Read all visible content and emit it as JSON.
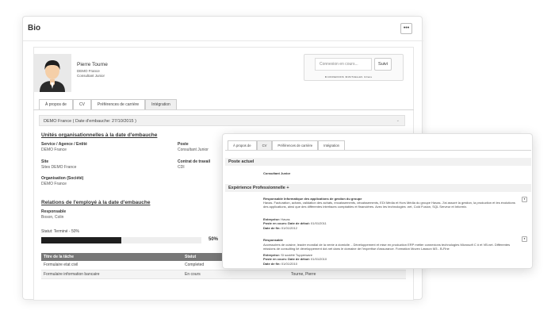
{
  "card": {
    "title": "Bio",
    "more_label": "•••"
  },
  "profile": {
    "name": "Pierre Tourne",
    "company": "DEMO France",
    "role": "Consultant Junior"
  },
  "connect": {
    "placeholder": "Connexion en cours...",
    "follow_label": "Suivi",
    "stats": {
      "connexions_count": "0",
      "connexions_label": "CONNEXIONS",
      "mutuelles_count": "0",
      "mutuelles_label": "MUTUELLES",
      "fans_count": "1",
      "fans_label": "Fans"
    }
  },
  "tabs": [
    {
      "label": "À propos de"
    },
    {
      "label": "CV"
    },
    {
      "label": "Préférences de carrière"
    },
    {
      "label": "Intégration"
    }
  ],
  "accordion": {
    "header": "DEMO France ( Date d'embauche: 27/10/2015 )"
  },
  "org_section": {
    "title": "Unités organisationnelles à la date d'embauche",
    "service_label": "Service / Agence / Entité",
    "service_value": "DEMO France",
    "poste_label": "Poste",
    "poste_value": "Consultant Junior",
    "site_label": "Site",
    "site_value": "Sites DEMO France",
    "contrat_label": "Contrat de travail",
    "contrat_value": "CDI",
    "organisation_label": "Organisation (Société)",
    "organisation_value": "DEMO France"
  },
  "relations_section": {
    "title": "Relations de l'employé à la date d'embauche",
    "responsable_label": "Responsable",
    "responsable_value": "Boson, Colin"
  },
  "status": {
    "label": "Statut: Terminé - 50%",
    "percent_text": "50%",
    "progress": 0.5
  },
  "task_table": {
    "headers": [
      "Titre de la tâche",
      "Statut"
    ],
    "rows": [
      {
        "title": "Formulaire etat civil",
        "status": "Completed",
        "extra": ""
      },
      {
        "title": "Formulaire information bancaire",
        "status": "En cours",
        "extra": "Tourne, Pierre"
      }
    ]
  },
  "overlay": {
    "tabs": [
      {
        "label": "À propos de"
      },
      {
        "label": "CV"
      },
      {
        "label": "Préférences de carrière"
      },
      {
        "label": "Intégration"
      }
    ],
    "poste_actuel": {
      "title": "Poste actuel",
      "value": "Consultant Junior"
    },
    "experience": {
      "title": "Expérience Professionnelle +",
      "items": [
        {
          "title": "Responsable Informatique des applications de gestion du groupe",
          "description": "Havas. Facturation, achats, validation des achats, encaissements, décaissements, EDI Média et Hors Média du groupe Havas. J'ai assuré la gestion, la production et les évolutions des applications, ainsi que des différentes interfaces comptables et financières. Avec les technologies .net, Cold Fusion, SQL Serveur et Informix.",
          "entreprise_label": "Entreprise:",
          "entreprise_value": "Havas",
          "poste_label": "Poste en cours:",
          "date_debut_label": "Date de début:",
          "date_debut_value": "01/01/2011",
          "date_fin_label": "Date de fin:",
          "date_fin_value": "01/01/2012"
        },
        {
          "title": "Responsable",
          "description": "Accessoires de cuisine, leader mondial de la vente à domicile. - Développement et mise en production ERP métier connexions technologies Microsoft C # et VB.net. Différentes missions de consulting lié développement dot.net dans le domaine de l'expertise d'assurance. Formation Movex Lawson M3 - B-Fine",
          "entreprise_label": "Entreprise:",
          "entreprise_value": "SI société Tupperware",
          "poste_label": "Poste en cours:",
          "date_debut_label": "Date de début:",
          "date_debut_value": "01/01/2010",
          "date_fin_label": "Date de fin:",
          "date_fin_value": "01/01/2010"
        }
      ]
    }
  }
}
